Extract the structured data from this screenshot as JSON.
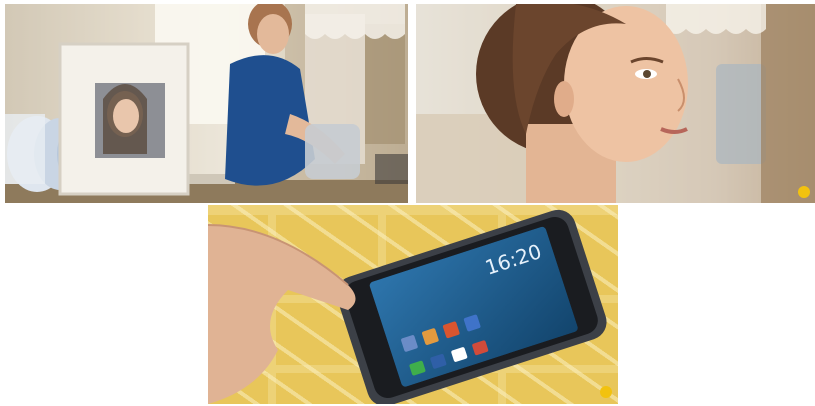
{
  "frames": [
    {
      "id": "kitchen",
      "description_name": "woman-in-kitchen-scene"
    },
    {
      "id": "face",
      "description_name": "woman-portrait-closeup"
    },
    {
      "id": "phone",
      "description_name": "hand-touching-smartphone"
    }
  ],
  "phone": {
    "clock_text": "16:20",
    "date_text": ""
  },
  "colors": {
    "phone_screen": "#1b5c8f",
    "tablecloth": "#e8c65a",
    "blouse": "#1f4f8f",
    "watermark": "#f2c20f"
  }
}
